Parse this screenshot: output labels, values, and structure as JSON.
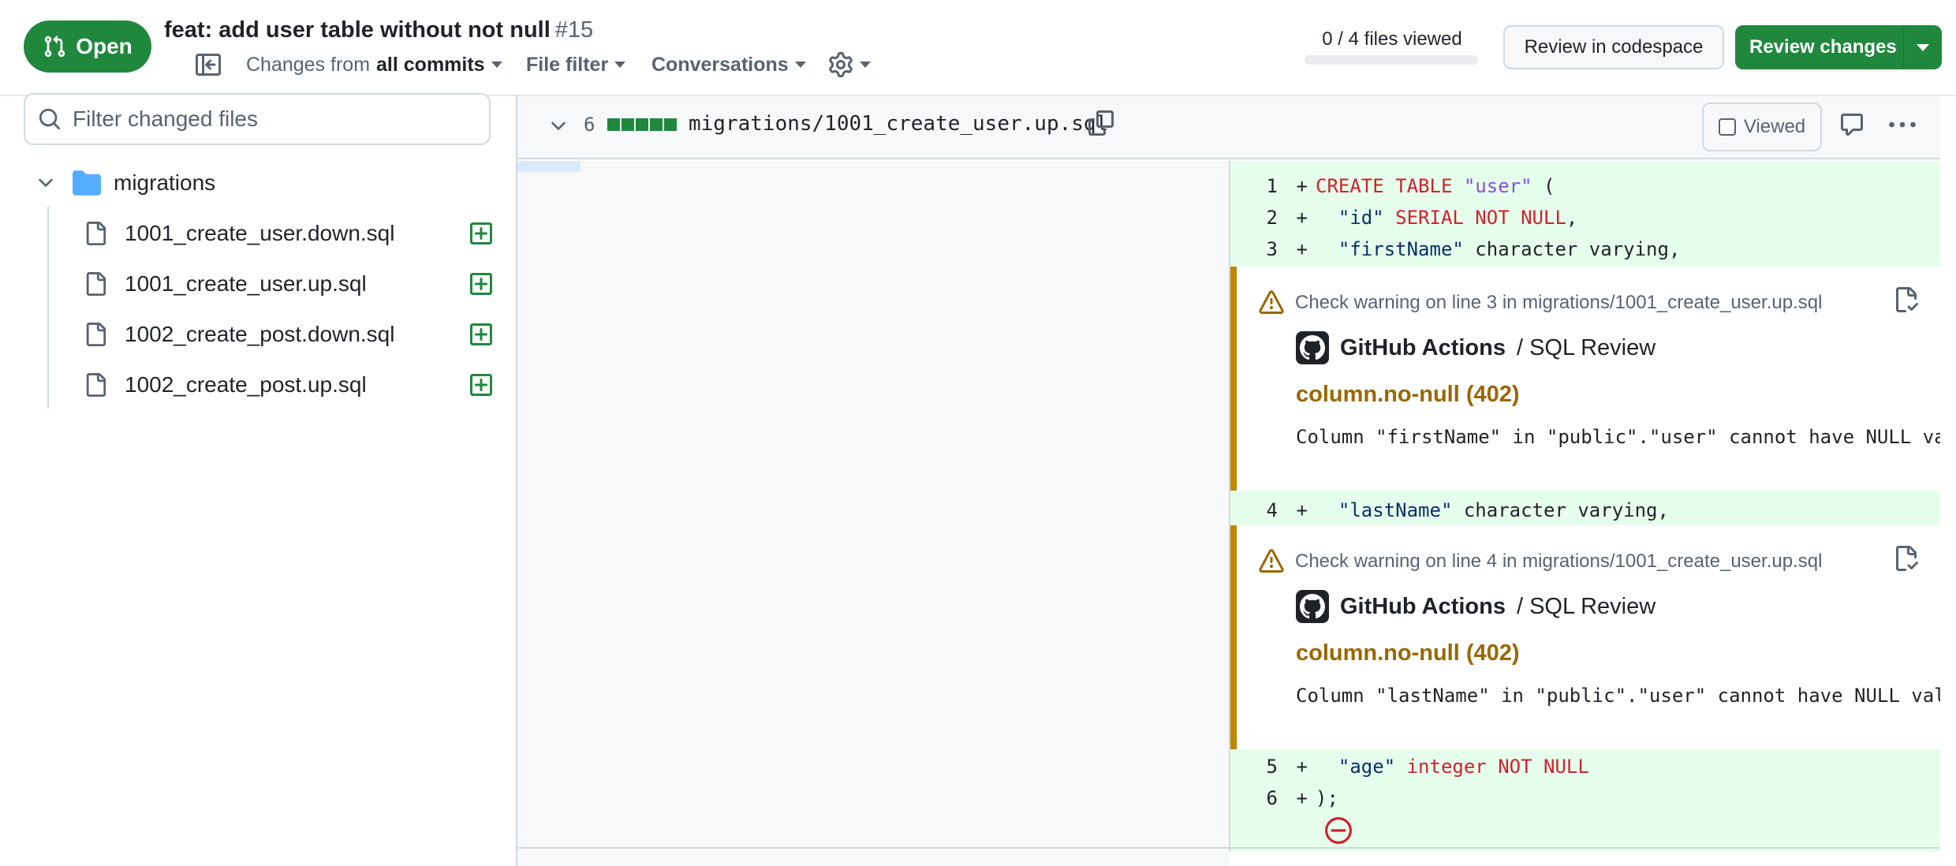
{
  "header": {
    "status_label": "Open",
    "pr_title": "feat: add user table without not null",
    "pr_number": "#15",
    "changes_prefix": "Changes from",
    "changes_value": "all commits",
    "file_filter": "File filter",
    "conversations": "Conversations",
    "files_viewed": "0 / 4 files viewed",
    "files_viewed_progress": 0,
    "review_codespace": "Review in codespace",
    "review_changes": "Review changes"
  },
  "sidebar": {
    "filter_placeholder": "Filter changed files",
    "folder": "migrations",
    "files": [
      "1001_create_user.down.sql",
      "1001_create_user.up.sql",
      "1002_create_post.down.sql",
      "1002_create_post.up.sql"
    ]
  },
  "diff": {
    "change_count": "6",
    "path": "migrations/1001_create_user.up.sql",
    "viewed_label": "Viewed",
    "lines": [
      {
        "num": "1",
        "sign": "+"
      },
      {
        "num": "2",
        "sign": "+"
      },
      {
        "num": "3",
        "sign": "+"
      },
      {
        "num": "4",
        "sign": "+"
      },
      {
        "num": "5",
        "sign": "+"
      },
      {
        "num": "6",
        "sign": "+"
      }
    ],
    "code": {
      "l1_kw": "CREATE TABLE",
      "l1_str": "\"user\"",
      "l1_rest": " (",
      "l2_str": "\"id\"",
      "l2_kw": "SERIAL NOT NULL",
      "l2_rest": ",",
      "l3_str": "\"firstName\"",
      "l3_rest": " character varying,",
      "l4_str": "\"lastName\"",
      "l4_rest": " character varying,",
      "l5_str": "\"age\"",
      "l5_kw": "integer NOT NULL",
      "l6_rest": ");"
    },
    "annotations": [
      {
        "header": "Check warning on line 3 in migrations/1001_create_user.up.sql",
        "app": "GitHub Actions",
        "workflow": "/ SQL Review",
        "rule": "column.no-null (402)",
        "message": "Column \"firstName\" in \"public\".\"user\" cannot have NULL value"
      },
      {
        "header": "Check warning on line 4 in migrations/1001_create_user.up.sql",
        "app": "GitHub Actions",
        "workflow": "/ SQL Review",
        "rule": "column.no-null (402)",
        "message": "Column \"lastName\" in \"public\".\"user\" cannot have NULL value"
      }
    ]
  },
  "colors": {
    "open_green": "#1f883d",
    "added_bg": "#e6ffec",
    "added_gutter": "#ccffd8",
    "warning": "#9a6700",
    "keyword": "#cf222e",
    "string": "#0a3069"
  }
}
